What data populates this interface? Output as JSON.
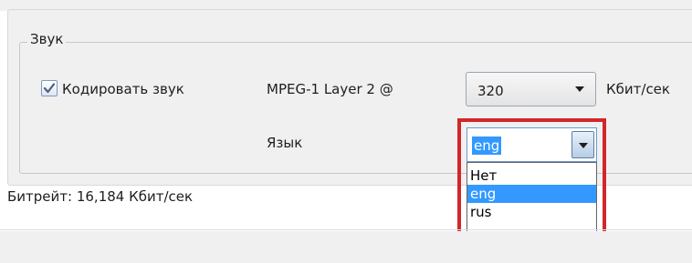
{
  "sound_group": {
    "title": "Звук",
    "encode_checkbox": {
      "label": "Кодировать звук",
      "checked": true
    },
    "codec_label": "MPEG-1 Layer 2 @",
    "bitrate_select": {
      "value": "320"
    },
    "bitrate_unit": "Кбит/сек",
    "language_label": "Язык",
    "language_select": {
      "value": "eng",
      "options": [
        "Нет",
        "eng",
        "rus"
      ],
      "selected_option": "eng"
    }
  },
  "status": {
    "bitrate_text": "Битрейт: 16,184 Кбит/сек"
  },
  "colors": {
    "highlight_border": "#d2262b",
    "selection": "#3399ff",
    "panel_background": "#f0f0f0"
  },
  "icons": {
    "checkbox": "checkmark-icon",
    "dropdown": "chevron-down-icon"
  }
}
